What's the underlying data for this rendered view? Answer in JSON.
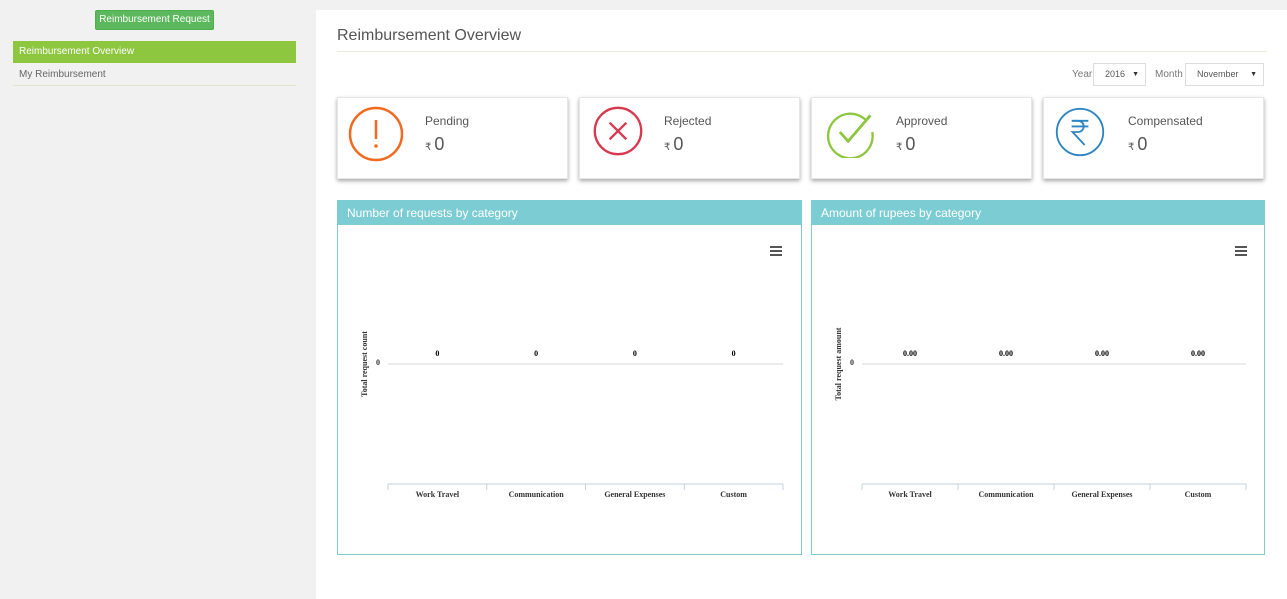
{
  "sidebar": {
    "request_button": "Reimbursement Request",
    "items": [
      {
        "label": "Reimbursement Overview",
        "active": true
      },
      {
        "label": "My Reimbursement",
        "active": false
      }
    ]
  },
  "main": {
    "title": "Reimbursement Overview",
    "filters": {
      "year_label": "Year",
      "year_value": "2016",
      "month_label": "Month",
      "month_value": "November"
    },
    "cards": [
      {
        "label": "Pending",
        "currency": "₹",
        "amount": "0",
        "icon": "exclamation-circle-icon",
        "color": "#f26a21"
      },
      {
        "label": "Rejected",
        "currency": "₹",
        "amount": "0",
        "icon": "x-circle-icon",
        "color": "#d9394e"
      },
      {
        "label": "Approved",
        "currency": "₹",
        "amount": "0",
        "icon": "check-circle-icon",
        "color": "#8dc63f"
      },
      {
        "label": "Compensated",
        "currency": "₹",
        "amount": "0",
        "icon": "rupee-circle-icon",
        "color": "#2e86c1"
      }
    ]
  },
  "colors": {
    "accent_green": "#8dc63f",
    "button_green": "#5cb85c",
    "panel_teal": "#7ccdd3"
  },
  "chart_data": [
    {
      "type": "bar",
      "title": "Number of requests by category",
      "ylabel": "Total request count",
      "yticks": [
        "0"
      ],
      "categories": [
        "Work Travel",
        "Communication",
        "General Expenses",
        "Custom"
      ],
      "values": [
        0,
        0,
        0,
        0
      ],
      "data_labels": [
        "0",
        "0",
        "0",
        "0"
      ]
    },
    {
      "type": "bar",
      "title": "Amount of rupees by category",
      "ylabel": "Total request amount",
      "yticks": [
        "0"
      ],
      "categories": [
        "Work Travel",
        "Communication",
        "General Expenses",
        "Custom"
      ],
      "values": [
        0.0,
        0.0,
        0.0,
        0.0
      ],
      "data_labels": [
        "0.00",
        "0.00",
        "0.00",
        "0.00"
      ]
    }
  ]
}
